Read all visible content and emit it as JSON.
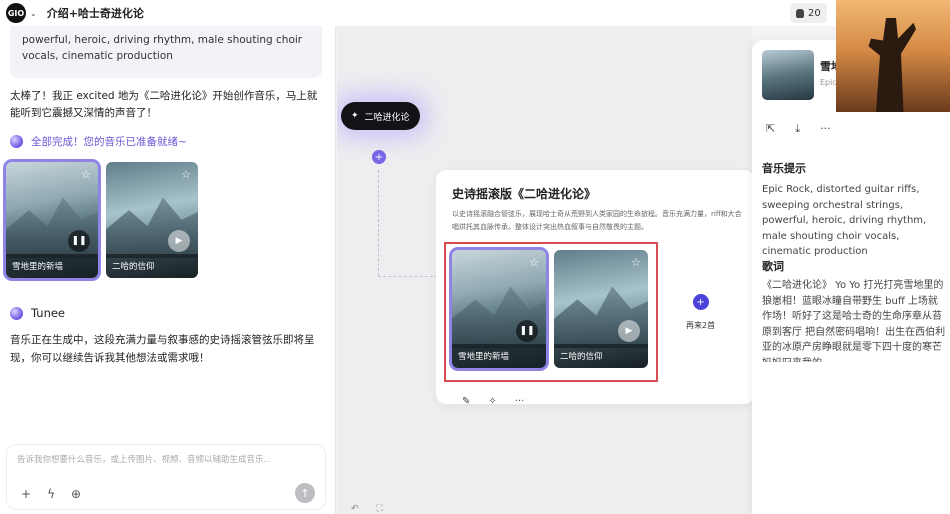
{
  "topbar": {
    "logo_text": "GIO",
    "caret": "⌄",
    "project_title": "介绍+哈士奇进化论",
    "credits": "20"
  },
  "chat": {
    "prompt_text": "powerful, heroic, driving rhythm, male shouting choir vocals, cinematic production",
    "message1": "太棒了！我正 excited 地为《二哈进化论》开始创作音乐，马上就能听到它震撼又深情的声音了！",
    "done_label": "全部完成！您的音乐已准备就绪~",
    "cards": [
      {
        "caption": "雪地里的新墙"
      },
      {
        "caption": "二哈的信仰"
      }
    ],
    "assistant_name": "Tunee",
    "message2": "音乐正在生成中，这段充满力量与叙事感的史诗摇滚管弦乐即将呈现，你可以继续告诉我其他想法或需求哦！",
    "input_placeholder": "告诉我你想要什么音乐，或上传图片、视频、音频以辅助生成音乐..."
  },
  "canvas": {
    "node_label": "二哈进化论",
    "result_title": "史诗摇滚版《二哈进化论》",
    "result_desc": "以史诗摇滚融合管弦乐，展现哈士奇从荒野到人类家园的生命旅程。音乐充满力量，riff和大合唱烘托其血脉传承。整体设计突出热血叙事与自然敬畏的主题。",
    "cards": [
      {
        "caption": "雪地里的新墙"
      },
      {
        "caption": "二哈的信仰"
      }
    ],
    "more_label": "再来2首"
  },
  "panel": {
    "song_name": "雪地",
    "song_sub": "Epic",
    "music_prompt_heading": "音乐提示",
    "music_prompt_text": "Epic Rock, distorted guitar riffs, sweeping orchestral strings, powerful, heroic, driving rhythm, male shouting choir vocals, cinematic production",
    "lyrics_heading": "歌词",
    "lyrics_text": "《二哈进化论》 Yo Yo 打光打亮雪地里的狼崽相！蓝眼冰瞳自带野生 buff 上场就作场！听好了这是哈士奇的生命序章从苔原到客厅 把自然密码唱响！出生在西伯利亚的冰原产房睁眼就是零下四十度的寒芒妈妈叼来我的"
  },
  "colors": {
    "accent": "#7767e6",
    "highlight_box": "#d64a52"
  }
}
